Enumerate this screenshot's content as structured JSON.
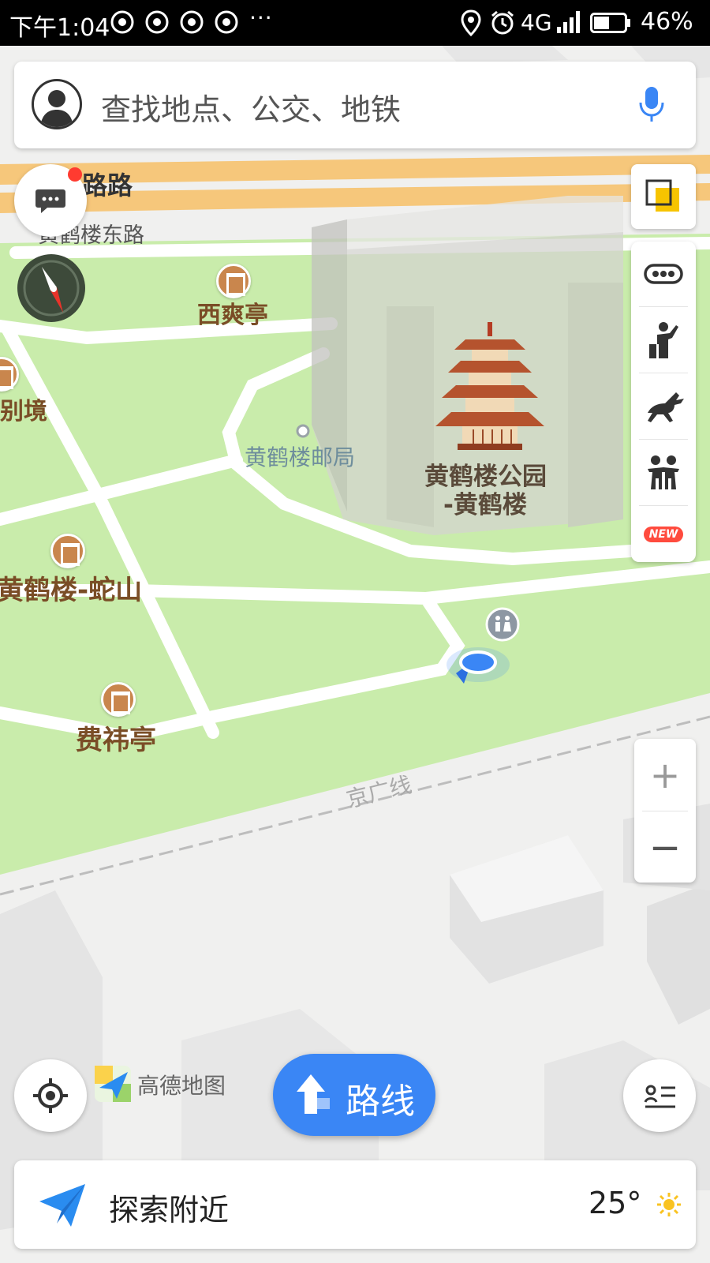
{
  "status_bar": {
    "time": "下午1:04",
    "more": "···",
    "network": "4G",
    "battery": "46%"
  },
  "search": {
    "placeholder": "查找地点、公交、地铁",
    "avatar_icon": "user-avatar-icon",
    "voice_icon": "microphone-icon"
  },
  "map": {
    "roads": [
      "路路",
      "黄鹤楼东路",
      "京广线"
    ],
    "pois": {
      "xishuang": "西爽亭",
      "biejing": "别境",
      "post_office": "黄鹤楼邮局",
      "park_line1": "黄鹤楼公园",
      "park_line2": "-黄鹤楼",
      "sheshan": "黄鹤楼-蛇山",
      "feiyi": "费祎亭"
    },
    "brand": "高德地图"
  },
  "controls": {
    "message_icon": "chat-bubble-icon",
    "compass_icon": "compass-icon",
    "layers_icon": "layers-icon",
    "traffic_icon": "traffic-icon",
    "guide_icon": "tour-guide-icon",
    "horse_icon": "horse-icon",
    "people_icon": "people-icon",
    "new_badge": "NEW",
    "zoom_in": "+",
    "zoom_out": "—",
    "locate_icon": "locate-icon",
    "list_icon": "list-icon"
  },
  "route_button": {
    "label": "路线"
  },
  "bottom_bar": {
    "explore": "探索附近",
    "temperature": "25°",
    "weather_icon": "sun-icon"
  },
  "colors": {
    "park_green": "#c9ecab",
    "road_orange": "#f6c77b",
    "accent_blue": "#3a86f5",
    "poi_brown": "#7a4d26",
    "badge_red": "#ff4b3e"
  }
}
